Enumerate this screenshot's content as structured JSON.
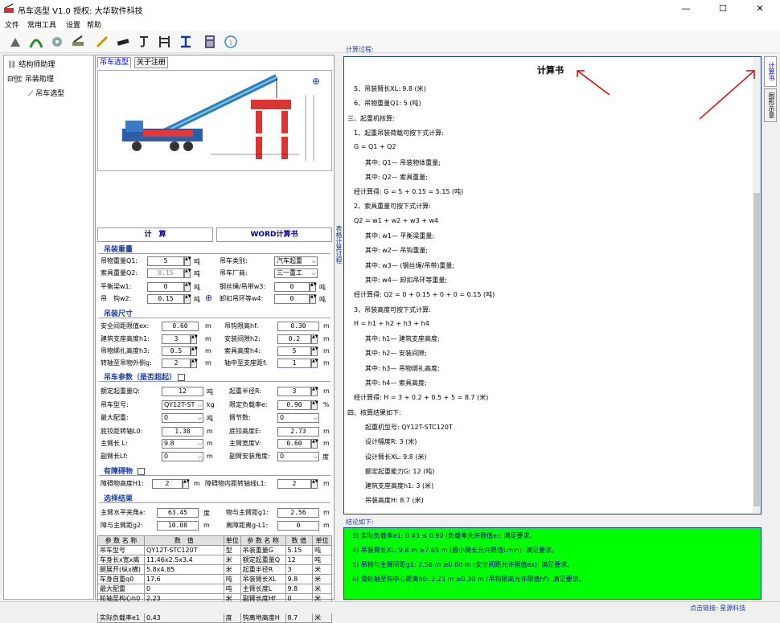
{
  "app": {
    "title": "吊车选型 V1.0 授权: 大华软件科技",
    "min": "—",
    "max": "☐",
    "close": "✕"
  },
  "menu": [
    "文件",
    "常用工具",
    "设置",
    "帮助"
  ],
  "tree": {
    "root": "结构师助理",
    "group": "吊装助理",
    "leaf": "吊车选型"
  },
  "tabs": {
    "t1": "吊车选型",
    "t2": "关于注册"
  },
  "buttons": {
    "calc": "计　算",
    "word": "WORD计算书"
  },
  "sec1": {
    "title": "吊装重量",
    "q1_label": "吊物重量Q1:",
    "q1": "5",
    "q1_unit": "吨",
    "type_label": "吊车类别:",
    "type": "汽车起重",
    "q2_label": "索具重量Q2:",
    "q2": "0.15",
    "q2_unit": "吨",
    "maker_label": "吊车厂商:",
    "maker": "三一重工",
    "w1_label": "平衡梁w1:",
    "w1": "0",
    "w1_unit": "吨",
    "w3_label": "钢丝绳/吊带w3:",
    "w3": "0",
    "w3_unit": "吨",
    "w2_label": "吊　钩w2:",
    "w2": "0.15",
    "w2_unit": "吨",
    "w4_label": "卸扣吊环等w4:",
    "w4": "0",
    "w4_unit": "吨"
  },
  "sec2": {
    "title": "吊装尺寸",
    "r1a_label": "安全间距限值ex:",
    "r1a": "0.60",
    "r1a_unit": "m",
    "r1b_label": "吊钩限高hf:",
    "r1b": "0.30",
    "r1b_unit": "m",
    "r2a_label": "建筑支座高度h1:",
    "r2a": "3",
    "r2a_unit": "m",
    "r2b_label": "安装间隙h2:",
    "r2b": "0.2",
    "r2b_unit": "m",
    "r3a_label": "吊物绑扎高度h3:",
    "r3a": "0.5",
    "r3a_unit": "m",
    "r3b_label": "索具高度h4:",
    "r3b": "5",
    "r3b_unit": "m",
    "r4a_label": "转轴至吊物外侧g:",
    "r4a": "2",
    "r4a_unit": "m",
    "r4b_label": "轴中至支座距f:",
    "r4b": "1",
    "r4b_unit": "m"
  },
  "sec3": {
    "title": "吊车参数（是否超起）",
    "r1a_label": "额定起重量Q:",
    "r1a": "12",
    "r1a_unit": "吨",
    "r1b_label": "起重半径R:",
    "r1b": "3",
    "r1b_unit": "m",
    "r2a_label": "吊车型号:",
    "r2a": "QY12T-ST",
    "r2a_unit": "kg",
    "r2b_label": "限定负载率e:",
    "r2b": "0.90",
    "r2b_unit": "%",
    "r3a_label": "最大配重:",
    "r3a": "0",
    "r3a_unit": "吨",
    "r3b_label": "臂节数:",
    "r3b": "0",
    "r4a_label": "底铰距转轴L0:",
    "r4a": "1.38",
    "r4a_unit": "m",
    "r4b_label": "底铰高度E:",
    "r4b": "2.73",
    "r4b_unit": "m",
    "r5a_label": "主臂长 L:",
    "r5a": "9.8",
    "r5a_unit": "m",
    "r5b_label": "主臂宽度V:",
    "r5b": "0.60",
    "r5b_unit": "m",
    "r6a_label": "副臂长Lf:",
    "r6a": "0",
    "r6a_unit": "m",
    "r6b_label": "副臂安装角度:",
    "r6b": "0",
    "r6b_unit": "度"
  },
  "sec4": {
    "title": "有障碍物",
    "a_label": "障碍物高度H1:",
    "a": "2",
    "a_unit": "m",
    "b_label": "障碍物内距转轴线L1:",
    "b": "2",
    "b_unit": "m"
  },
  "sec5": {
    "title": "选择结果",
    "r1a_label": "主臂水平夹角a:",
    "r1a": "63.45",
    "r1a_unit": "度",
    "r1b_label": "物与主臂距g1:",
    "r1b": "2.56",
    "r1b_unit": "m",
    "r2a_label": "障与主臂距g2:",
    "r2a": "10.08",
    "r2a_unit": "m",
    "r2b_label": "离障距离g-L1:",
    "r2b": "0",
    "r2b_unit": "m"
  },
  "table": {
    "head": [
      "参 数 名 称",
      "数　值",
      "单位",
      "参 数 名 称",
      "数 值",
      "单位"
    ],
    "rows": [
      [
        "吊车型号",
        "QY12T-STC120T",
        "型",
        "吊装重量G",
        "5.15",
        "吨"
      ],
      [
        "车身长x宽x高",
        "11.46x2.5x3.4",
        "米",
        "额定起重量Q",
        "12",
        "吨"
      ],
      [
        "腿展开(纵x横)",
        "5.8x4.85",
        "米",
        "起重半径R",
        "3",
        "米"
      ],
      [
        "车身自重q0",
        "17.6",
        "吨",
        "吊装臂长XL",
        "9.8",
        "米"
      ],
      [
        "最大配重",
        "0",
        "吨",
        "主臂长度L",
        "9.8",
        "米"
      ],
      [
        "轮轴至构心h0",
        "2.23",
        "米",
        "副臂长度Hf",
        "0",
        "米"
      ],
      [
        "最小臂长Lmin",
        "7.65",
        "米",
        "起升高度Hz",
        "11.5",
        "米"
      ],
      [
        "实际负载率e1",
        "0.43",
        "度",
        "钩离地高度H",
        "8.7",
        "米"
      ]
    ]
  },
  "vside": "表格计算过程",
  "calc": {
    "caption": "计算过程:",
    "title": "计算书",
    "lines": [
      "5、吊装臂长XL: 9.8 (米)",
      "6、吊物重量Q1: 5 (吨)",
      "三、起重机核算:",
      "1、起重吊装荷载可按下式计算:",
      "G = Q1 + Q2",
      "其中: Q1— 吊装物体重量;",
      "其中: Q2— 索具重量;",
      "经计算得: G = 5 + 0.15 = 5.15 (吨)",
      "2、索具重量可按下式计算:",
      "Q2 = w1 + w2 + w3 + w4",
      "其中: w1— 平衡梁重量;",
      "其中: w2— 吊钩重量;",
      "其中: w3— (钢丝绳/吊带)重量;",
      "其中: w4— 卸扣吊环等重量;",
      "经计算得: Q2 = 0 + 0.15 + 0 + 0 = 0.15 (吨)",
      "3、吊装高度可按下式计算:",
      "H = h1 + h2 + h3 + h4",
      "其中: h1— 建筑支座高度;",
      "其中: h2— 安装间隙;",
      "其中: h3— 吊物绑扎高度;",
      "其中: h4— 索具高度;",
      "经计算得: H = 3 + 0.2 + 0.5 + 5 = 8.7 (米)",
      "四、核算结果如下:",
      "起重机型号: QY12T-STC120T",
      "设计幅度R: 3 (米)",
      "设计臂长XL: 9.8 (米)",
      "额定起重能力G: 12 (吨)",
      "建筑支座高度h1: 3 (米)",
      "吊装高度H: 8.7 (米)"
    ]
  },
  "conclusion": {
    "caption": "结论如下:",
    "lines": [
      "3) 实际负载率e1: 0.43 ≤ 0.90 (负载率允许限值e): 满足要求。",
      "4) 吊装臂长XL: 9.8 m ≥7.65 m (最小臂长允许限值Lmin): 满足要求。",
      "5) 吊物与主臂间距g1: 2.56 m ≥0.60 m (安全间距允许限值ex): 满足要求。",
      "6) 滑轮轴至钩中心距离h0: 2.23 m ≥0.30 m (吊钩限高允许限值hf): 满足要求。"
    ]
  },
  "rtabs": {
    "t1": "计算书",
    "t2": "图形示意"
  },
  "status": {
    "link": "点击链接: 星源科技"
  },
  "colors": {
    "accent": "#1a3aa0",
    "result_bg": "#00ff00",
    "annotation": "#e00000"
  }
}
